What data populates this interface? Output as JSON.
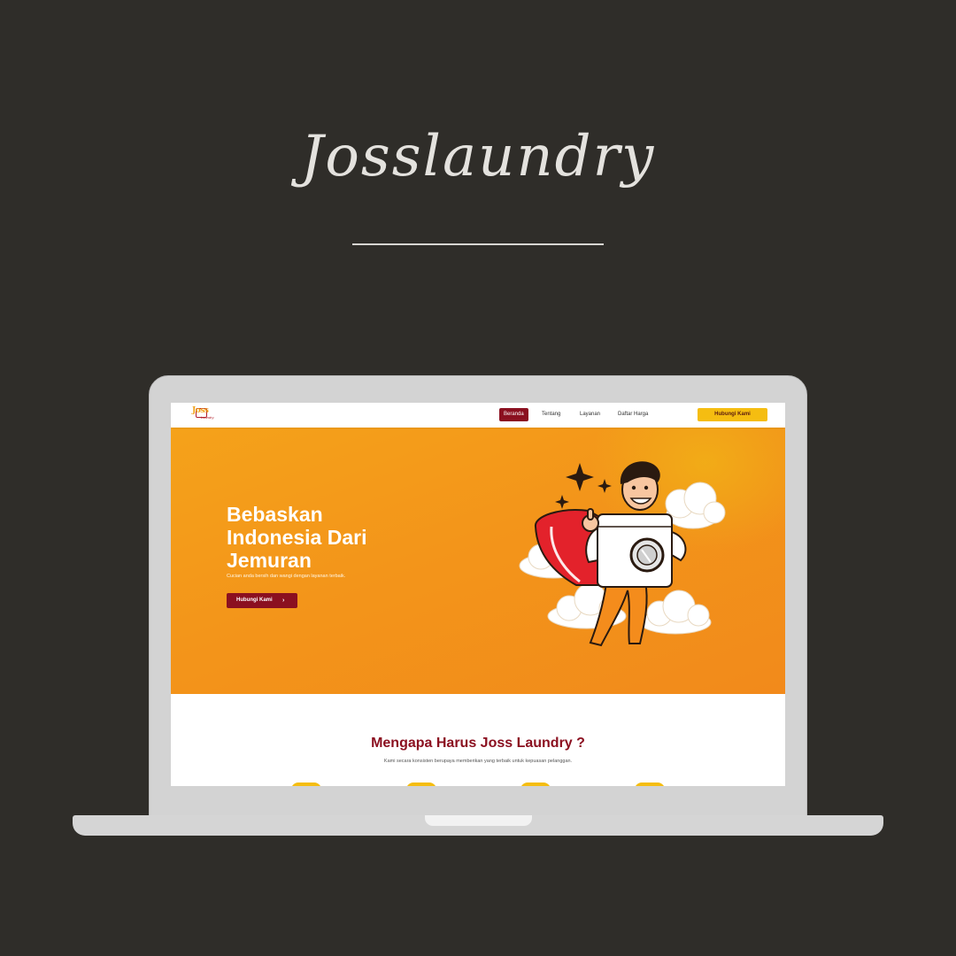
{
  "brand": {
    "title": "Josslaundry"
  },
  "site": {
    "logo": {
      "text": "Joss",
      "sub": "Laundry"
    },
    "nav": {
      "links": [
        "Beranda",
        "Tentang",
        "Layanan",
        "Daftar Harga"
      ],
      "active_index": 0,
      "cta": "Hubungi Kami"
    },
    "hero": {
      "title_lines": [
        "Bebaskan",
        "Indonesia Dari",
        "Jemuran"
      ],
      "subtitle": "Cucian anda bersih dan wangi dengan layanan terbaik.",
      "button": "Hubungi Kami",
      "button_arrow": "›"
    },
    "why": {
      "title": "Mengapa Harus Joss Laundry ?",
      "subtitle": "Kami secara konsisten berupaya memberikan yang terbaik untuk kepuasan pelanggan."
    }
  },
  "colors": {
    "background": "#2f2d29",
    "hero_orange": "#f5a21a",
    "maroon": "#8b1020",
    "yellow": "#f5bd11"
  }
}
